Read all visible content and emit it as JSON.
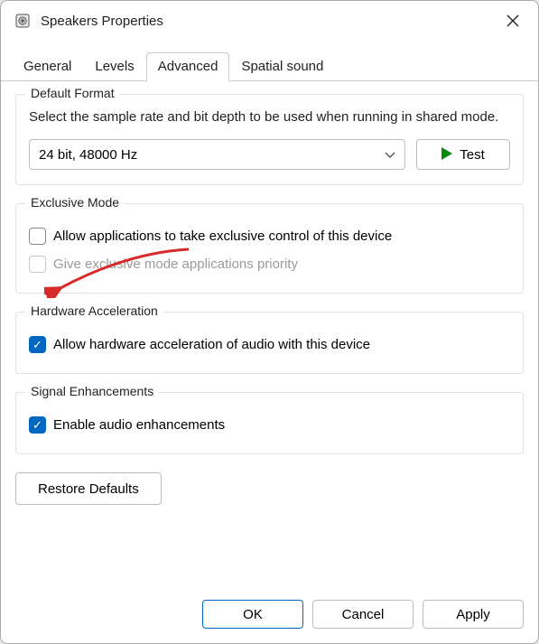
{
  "window": {
    "title": "Speakers Properties"
  },
  "tabs": {
    "general": "General",
    "levels": "Levels",
    "advanced": "Advanced",
    "spatial": "Spatial sound"
  },
  "default_format": {
    "title": "Default Format",
    "desc": "Select the sample rate and bit depth to be used when running in shared mode.",
    "selected": "24 bit, 48000 Hz",
    "test_label": "Test"
  },
  "exclusive_mode": {
    "title": "Exclusive Mode",
    "allow_label": "Allow applications to take exclusive control of this device",
    "priority_label": "Give exclusive mode applications priority"
  },
  "hardware_accel": {
    "title": "Hardware Acceleration",
    "allow_label": "Allow hardware acceleration of audio with this device"
  },
  "signal_enh": {
    "title": "Signal Enhancements",
    "enable_label": "Enable audio enhancements"
  },
  "restore_label": "Restore Defaults",
  "buttons": {
    "ok": "OK",
    "cancel": "Cancel",
    "apply": "Apply"
  }
}
